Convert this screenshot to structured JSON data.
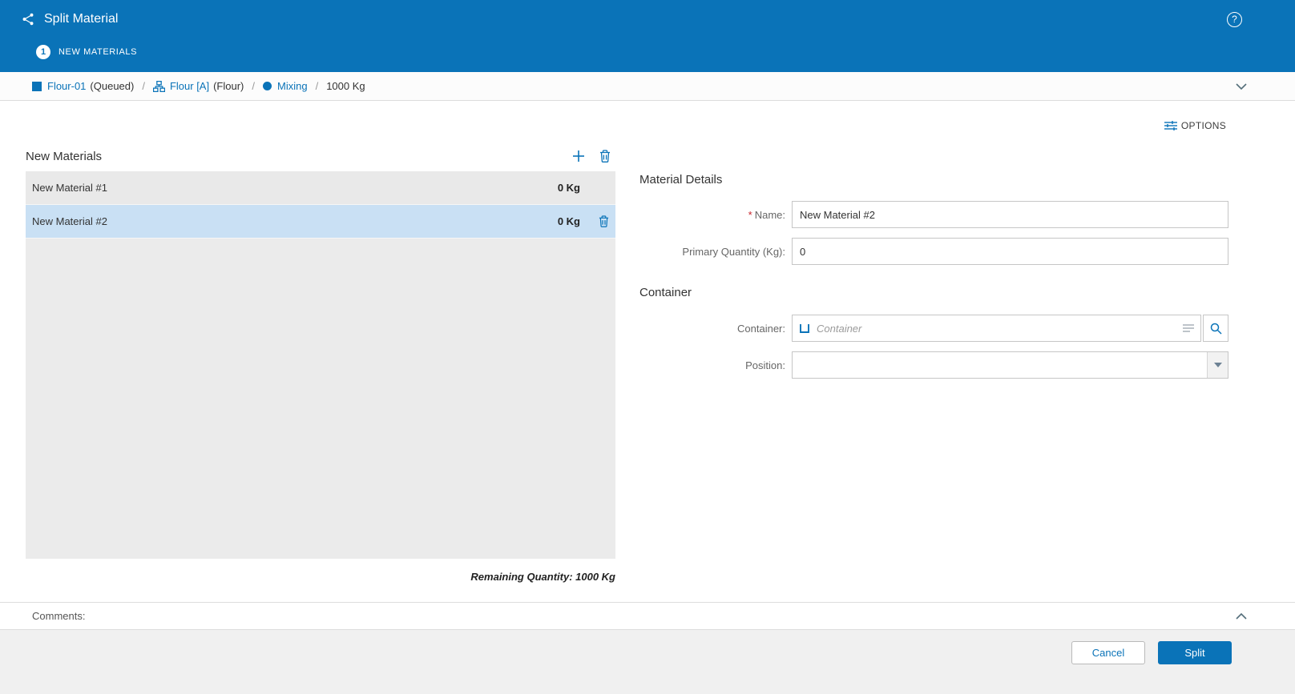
{
  "colors": {
    "header_blue": "#0a73b8",
    "link_blue": "#0a73b8",
    "selected_row_blue": "#c9e0f4",
    "list_background": "#ebebeb",
    "footer_background": "#f0f0f0",
    "required_red": "#c9252d"
  },
  "header": {
    "title": "Split Material",
    "help_glyph": "?",
    "step": {
      "number": "1",
      "label": "NEW MATERIALS"
    }
  },
  "breadcrumb": {
    "separator": "/",
    "items": [
      {
        "label": "Flour-01",
        "suffix": "(Queued)"
      },
      {
        "label": "Flour [A]",
        "suffix": "(Flour)"
      },
      {
        "label": "Mixing",
        "suffix": ""
      }
    ],
    "quantity": "1000 Kg"
  },
  "toolbar": {
    "options_label": "OPTIONS"
  },
  "materials": {
    "title": "New Materials",
    "rows": [
      {
        "name": "New Material #1",
        "qty": "0 Kg"
      },
      {
        "name": "New Material #2",
        "qty": "0 Kg"
      }
    ],
    "remaining": "Remaining Quantity: 1000 Kg"
  },
  "details": {
    "title": "Material Details",
    "required_marker": "*",
    "name_label": "Name:",
    "name_value": "New Material #2",
    "quantity_label": "Primary Quantity (Kg):",
    "quantity_value": "0",
    "container_section": "Container",
    "container_label": "Container:",
    "container_placeholder": "Container",
    "position_label": "Position:",
    "position_value": ""
  },
  "comments": {
    "label": "Comments:"
  },
  "footer": {
    "cancel_label": "Cancel",
    "split_label": "Split"
  }
}
